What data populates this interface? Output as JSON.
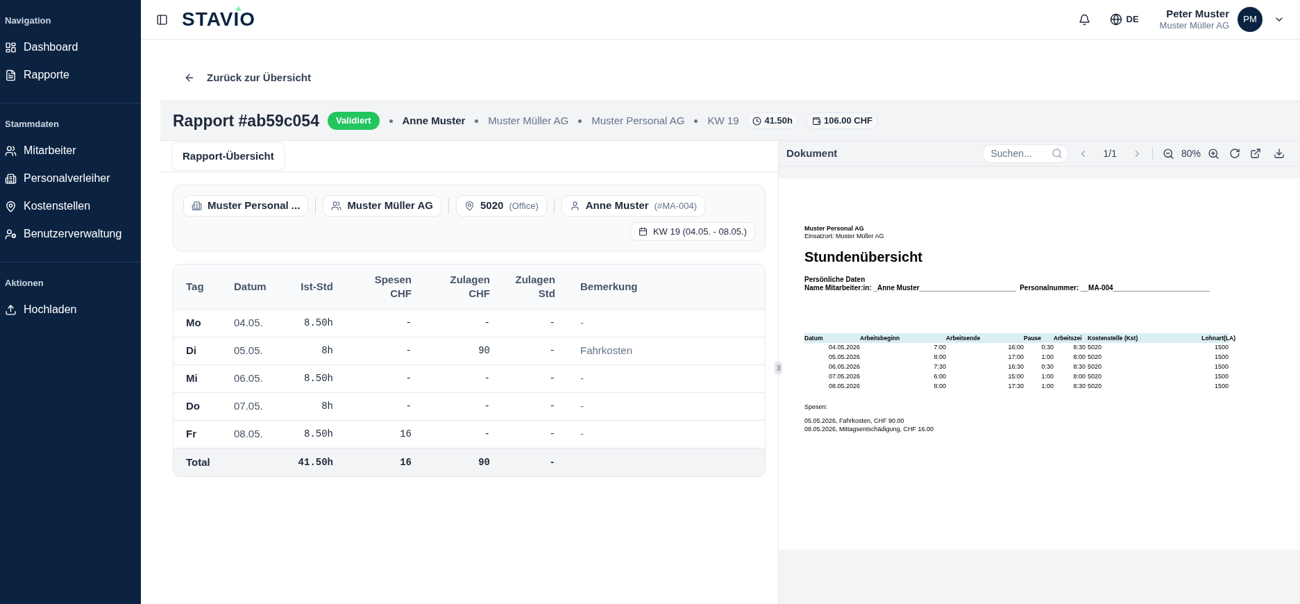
{
  "sidebar": {
    "sections": [
      {
        "title": "Navigation",
        "items": [
          {
            "label": "Dashboard"
          },
          {
            "label": "Rapporte"
          }
        ]
      },
      {
        "title": "Stammdaten",
        "items": [
          {
            "label": "Mitarbeiter"
          },
          {
            "label": "Personalverleiher"
          },
          {
            "label": "Kostenstellen"
          },
          {
            "label": "Benutzerverwaltung"
          }
        ]
      },
      {
        "title": "Aktionen",
        "items": [
          {
            "label": "Hochladen"
          }
        ]
      }
    ]
  },
  "header": {
    "logo": "STAVIO",
    "language": "DE",
    "user": {
      "name": "Peter Muster",
      "company": "Muster Müller AG",
      "initials": "PM"
    }
  },
  "back_link": "Zurück zur Übersicht",
  "report": {
    "title": "Rapport #ab59c054",
    "status": {
      "label": "Validiert",
      "kind": "validated"
    },
    "meta": [
      {
        "text": "Anne Muster",
        "emphasis": true
      },
      {
        "text": "Muster Müller AG",
        "emphasis": false
      },
      {
        "text": "Muster Personal AG",
        "emphasis": false
      },
      {
        "text": "KW 19",
        "emphasis": false
      }
    ],
    "chips": [
      {
        "kind": "hours",
        "text": "41.50h"
      },
      {
        "kind": "money",
        "text": "106.00 CHF"
      }
    ]
  },
  "tabs": [
    {
      "label": "Rapport-Übersicht",
      "selected": true
    }
  ],
  "info": {
    "chips": [
      {
        "kind": "agency",
        "label": "Muster Personal ..."
      },
      {
        "kind": "client",
        "label": "Muster Müller AG"
      },
      {
        "kind": "location",
        "label": "5020",
        "sub": "(Office)"
      },
      {
        "kind": "person",
        "label": "Anne Muster",
        "sub": "(#MA-004)"
      }
    ],
    "week": "KW 19 (04.05. - 08.05.)"
  },
  "table": {
    "columns": [
      "Tag",
      "Datum",
      "Ist-Std",
      "Spesen CHF",
      "Zulagen CHF",
      "Zulagen Std",
      "Bemerkung"
    ],
    "rows": [
      [
        "Mo",
        "04.05.",
        "8.50h",
        "-",
        "-",
        "-",
        "-"
      ],
      [
        "Di",
        "05.05.",
        "8h",
        "-",
        "90",
        "-",
        "Fahrkosten"
      ],
      [
        "Mi",
        "06.05.",
        "8.50h",
        "-",
        "-",
        "-",
        "-"
      ],
      [
        "Do",
        "07.05.",
        "8h",
        "-",
        "-",
        "-",
        "-"
      ],
      [
        "Fr",
        "08.05.",
        "8.50h",
        "16",
        "-",
        "-",
        "-"
      ]
    ],
    "total": [
      "Total",
      "41.50h",
      "16",
      "90",
      "-"
    ]
  },
  "document": {
    "title": "Dokument",
    "search": {
      "placeholder": "Suchen..."
    },
    "page": "1/1",
    "zoom": "80%",
    "pdf": {
      "company": "Muster Personal AG",
      "site": "Einsatzort: Muster Müller AG",
      "heading": "Stundenübersicht",
      "section": "Persönliche Daten",
      "name_line": "Name Mitarbeiter:in: _Anne Muster_________________________  Personalnummer: __MA-004_________________________",
      "columns": [
        "Datum",
        "Arbeitsbeginn",
        "Arbeitsende",
        "Pause",
        "Arbeitszei",
        "Kostenstelle (Kst)",
        "Lohnart(LA)"
      ],
      "rows": [
        [
          "04.05.2026",
          "7:00",
          "16:00",
          "0:30",
          "8:30",
          "5020",
          "1500"
        ],
        [
          "05.05.2026",
          "8:00",
          "17:00",
          "1:00",
          "8:00",
          "5020",
          "1500"
        ],
        [
          "06.05.2026",
          "7:30",
          "16:30",
          "0:30",
          "8:30",
          "5020",
          "1500"
        ],
        [
          "07.05.2026",
          "6:00",
          "15:00",
          "1:00",
          "8:00",
          "5020",
          "1500"
        ],
        [
          "08.05.2026",
          "8:00",
          "17:30",
          "1:00",
          "8:30",
          "5020",
          "1500"
        ]
      ],
      "expenses_title": "Spesen:",
      "expenses": [
        "05.05.2026, Fahrkosten, CHF 90.00",
        "08.05.2026, Mittagsentschädigung, CHF 16.00"
      ]
    }
  }
}
